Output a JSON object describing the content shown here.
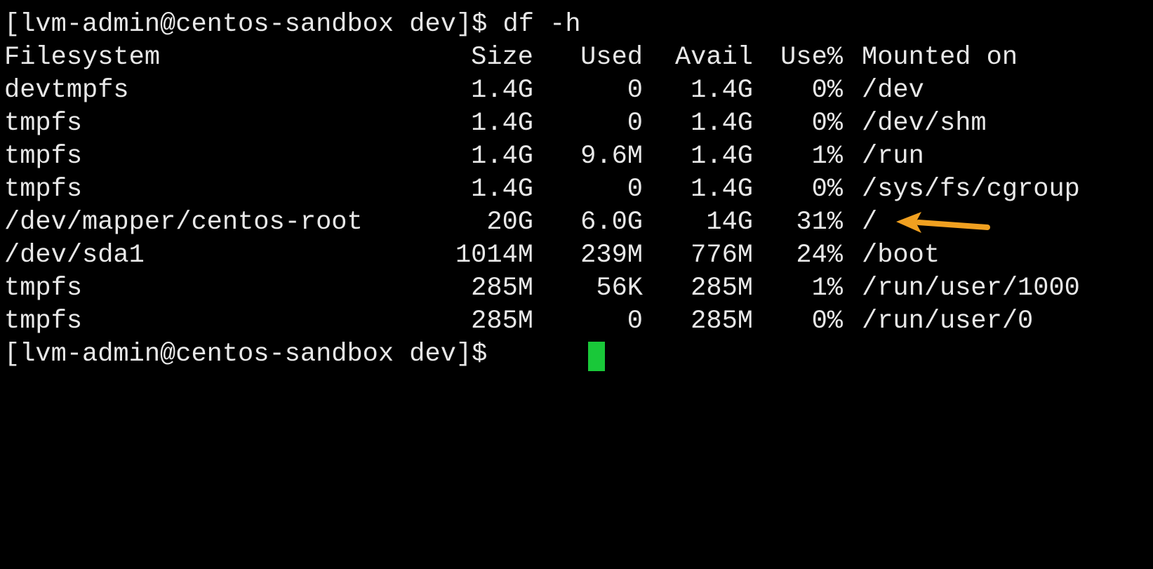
{
  "terminal": {
    "command_line": "[lvm-admin@centos-sandbox dev]$ df -h",
    "final_prompt": "[lvm-admin@centos-sandbox dev]$",
    "cursor_color": "#19c839",
    "arrow_color": "#f0a020"
  },
  "table": {
    "headers": {
      "filesystem": "Filesystem",
      "size": "Size",
      "used": "Used",
      "avail": "Avail",
      "use_pct": "Use%",
      "mounted_on": "Mounted on"
    },
    "rows": [
      {
        "filesystem": "devtmpfs",
        "size": "1.4G",
        "used": "0",
        "avail": "1.4G",
        "use_pct": "0%",
        "mounted_on": "/dev"
      },
      {
        "filesystem": "tmpfs",
        "size": "1.4G",
        "used": "0",
        "avail": "1.4G",
        "use_pct": "0%",
        "mounted_on": "/dev/shm"
      },
      {
        "filesystem": "tmpfs",
        "size": "1.4G",
        "used": "9.6M",
        "avail": "1.4G",
        "use_pct": "1%",
        "mounted_on": "/run"
      },
      {
        "filesystem": "tmpfs",
        "size": "1.4G",
        "used": "0",
        "avail": "1.4G",
        "use_pct": "0%",
        "mounted_on": "/sys/fs/cgroup"
      },
      {
        "filesystem": "/dev/mapper/centos-root",
        "size": "20G",
        "used": "6.0G",
        "avail": "14G",
        "use_pct": "31%",
        "mounted_on": "/"
      },
      {
        "filesystem": "/dev/sda1",
        "size": "1014M",
        "used": "239M",
        "avail": "776M",
        "use_pct": "24%",
        "mounted_on": "/boot"
      },
      {
        "filesystem": "tmpfs",
        "size": "285M",
        "used": "56K",
        "avail": "285M",
        "use_pct": "1%",
        "mounted_on": "/run/user/1000"
      },
      {
        "filesystem": "tmpfs",
        "size": "285M",
        "used": "0",
        "avail": "285M",
        "use_pct": "0%",
        "mounted_on": "/run/user/0"
      }
    ]
  }
}
